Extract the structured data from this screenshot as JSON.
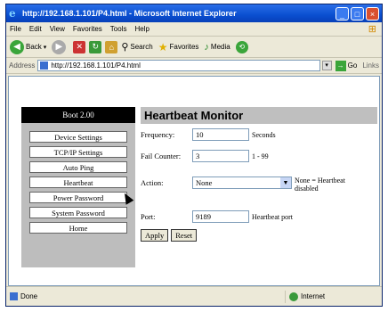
{
  "window": {
    "title": "http://192.168.1.101/P4.html - Microsoft Internet Explorer",
    "controls": {
      "minimize": "_",
      "maximize": "□",
      "close": "×"
    }
  },
  "menu": [
    "File",
    "Edit",
    "View",
    "Favorites",
    "Tools",
    "Help"
  ],
  "toolbar": {
    "back_label": "Back",
    "search_label": "Search",
    "favorites_label": "Favorites",
    "media_label": "Media"
  },
  "address": {
    "label": "Address",
    "url": "http://192.168.1.101/P4.html",
    "go_label": "Go",
    "links_label": "Links"
  },
  "sidebar": {
    "boot_label": "Boot 2.00",
    "items": [
      "Device Settings",
      "TCP/IP Settings",
      "Auto Ping",
      "Heartbeat",
      "Power Password",
      "System Password",
      "Home"
    ]
  },
  "main": {
    "heading": "Heartbeat Monitor",
    "frequency": {
      "label": "Frequency:",
      "value": "10",
      "unit": "Seconds"
    },
    "fail_counter": {
      "label": "Fail Counter:",
      "value": "3",
      "range": "1 - 99"
    },
    "action": {
      "label": "Action:",
      "selected": "None",
      "note": "None = Heartbeat disabled"
    },
    "port": {
      "label": "Port:",
      "value": "9189",
      "note": "Heartbeat port"
    },
    "apply_label": "Apply",
    "reset_label": "Reset"
  },
  "status": {
    "left": "Done",
    "zone": "Internet"
  },
  "colors": {
    "titlebar": "#0a4fd0",
    "sidebar": "#bdbdbd",
    "heading_bg": "#bfbfbf"
  }
}
